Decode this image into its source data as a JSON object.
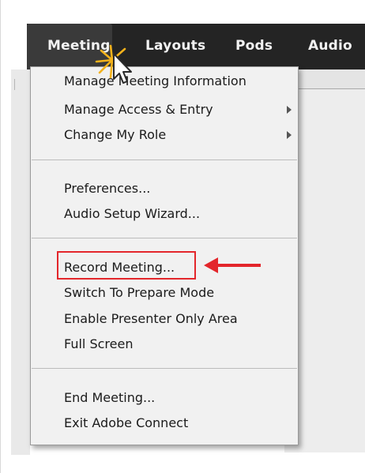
{
  "menubar": {
    "items": [
      {
        "label": "Meeting"
      },
      {
        "label": "Layouts"
      },
      {
        "label": "Pods"
      },
      {
        "label": "Audio"
      }
    ]
  },
  "dropdown": {
    "groups": [
      [
        {
          "label": "Manage Meeting Information"
        },
        {
          "label": "Manage Access & Entry"
        },
        {
          "label": "Change My Role"
        }
      ],
      [
        {
          "label": "Preferences..."
        },
        {
          "label": "Audio Setup Wizard..."
        }
      ],
      [
        {
          "label": "Record Meeting..."
        },
        {
          "label": "Switch To Prepare Mode"
        },
        {
          "label": "Enable Presenter Only Area"
        },
        {
          "label": "Full Screen"
        }
      ],
      [
        {
          "label": "End Meeting..."
        },
        {
          "label": "Exit Adobe Connect"
        }
      ]
    ]
  },
  "annotation": {
    "highlight_color": "#e3262b",
    "arrow_color": "#e3262b",
    "cursor_burst_color": "#f3b21b"
  },
  "icons": {
    "submenu": "chevron-right-icon",
    "cursor": "mouse-pointer-icon"
  }
}
